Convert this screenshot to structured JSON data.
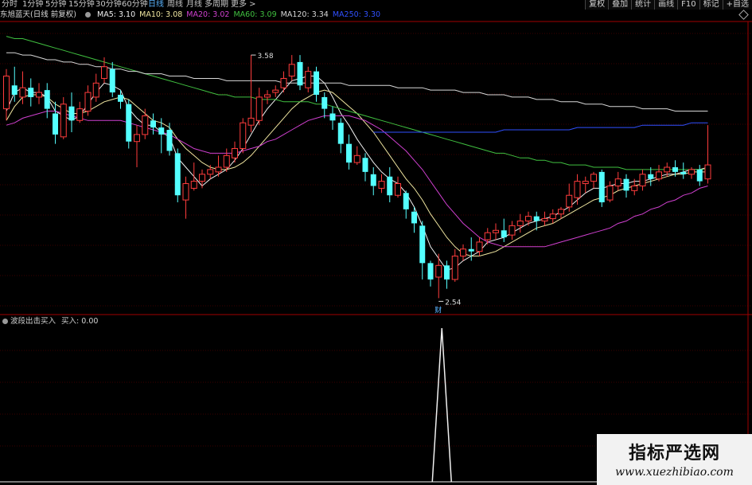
{
  "timeframes": [
    {
      "label": "分时",
      "active": false
    },
    {
      "label": "1分钟",
      "active": false
    },
    {
      "label": "5分钟",
      "active": false
    },
    {
      "label": "15分钟",
      "active": false
    },
    {
      "label": "30分钟",
      "active": false
    },
    {
      "label": "60分钟",
      "active": false
    },
    {
      "label": "日线",
      "active": true
    },
    {
      "label": "周线",
      "active": false
    },
    {
      "label": "月线",
      "active": false
    },
    {
      "label": "多周期",
      "active": false
    },
    {
      "label": "更多 >",
      "active": false
    }
  ],
  "tools": [
    "复权",
    "叠加",
    "统计",
    "画线",
    "F10",
    "标记",
    "+自选"
  ],
  "stock": {
    "name": "东旭蓝天(日线 前复权)"
  },
  "ma_legend": [
    {
      "label": "MA5: 3.10",
      "color": "#f0f0f0"
    },
    {
      "label": "MA10: 3.08",
      "color": "#f0e6a0"
    },
    {
      "label": "MA20: 3.02",
      "color": "#d040d0"
    },
    {
      "label": "MA60: 3.09",
      "color": "#40c040"
    },
    {
      "label": "MA120: 3.34",
      "color": "#d8d8d8"
    },
    {
      "label": "MA250: 3.30",
      "color": "#3050ff"
    }
  ],
  "indicator": {
    "name": "波段出击买入",
    "value_label": "买入: 0.00"
  },
  "annotations": {
    "high": "3.58",
    "low": "2.54",
    "marker": "财"
  },
  "watermark": {
    "title": "指标严选网",
    "url": "www.xuezhibiao.com"
  },
  "chart_data": {
    "type": "candlestick",
    "ylim": [
      2.48,
      3.72
    ],
    "candles": [
      [
        3.35,
        3.49,
        3.52,
        3.3
      ],
      [
        3.45,
        3.41,
        3.53,
        3.38
      ],
      [
        3.4,
        3.44,
        3.51,
        3.37
      ],
      [
        3.44,
        3.4,
        3.48,
        3.36
      ],
      [
        3.4,
        3.42,
        3.46,
        3.37
      ],
      [
        3.43,
        3.35,
        3.46,
        3.31
      ],
      [
        3.33,
        3.24,
        3.38,
        3.2
      ],
      [
        3.23,
        3.37,
        3.4,
        3.22
      ],
      [
        3.36,
        3.3,
        3.42,
        3.25
      ],
      [
        3.3,
        3.35,
        3.38,
        3.29
      ],
      [
        3.34,
        3.42,
        3.45,
        3.32
      ],
      [
        3.4,
        3.46,
        3.5,
        3.38
      ],
      [
        3.48,
        3.53,
        3.57,
        3.46
      ],
      [
        3.52,
        3.42,
        3.55,
        3.4
      ],
      [
        3.41,
        3.38,
        3.43,
        3.35
      ],
      [
        3.37,
        3.21,
        3.39,
        3.18
      ],
      [
        3.21,
        3.24,
        3.28,
        3.1
      ],
      [
        3.24,
        3.32,
        3.35,
        3.22
      ],
      [
        3.3,
        3.27,
        3.33,
        3.24
      ],
      [
        3.27,
        3.24,
        3.31,
        3.16
      ],
      [
        3.26,
        3.17,
        3.29,
        3.15
      ],
      [
        3.16,
        2.98,
        3.18,
        2.95
      ],
      [
        2.96,
        3.03,
        3.06,
        2.88
      ],
      [
        3.01,
        3.04,
        3.12,
        3.0
      ],
      [
        3.04,
        3.07,
        3.09,
        3.01
      ],
      [
        3.07,
        3.09,
        3.11,
        3.05
      ],
      [
        3.08,
        3.1,
        3.15,
        3.06
      ],
      [
        3.1,
        3.15,
        3.18,
        3.08
      ],
      [
        3.14,
        3.18,
        3.21,
        3.12
      ],
      [
        3.18,
        3.29,
        3.31,
        3.16
      ],
      [
        3.28,
        3.31,
        3.58,
        3.25
      ],
      [
        3.3,
        3.4,
        3.44,
        3.28
      ],
      [
        3.4,
        3.41,
        3.43,
        3.37
      ],
      [
        3.42,
        3.43,
        3.45,
        3.4
      ],
      [
        3.44,
        3.48,
        3.51,
        3.42
      ],
      [
        3.49,
        3.54,
        3.58,
        3.47
      ],
      [
        3.55,
        3.45,
        3.58,
        3.43
      ],
      [
        3.44,
        3.51,
        3.53,
        3.42
      ],
      [
        3.51,
        3.41,
        3.53,
        3.38
      ],
      [
        3.4,
        3.35,
        3.42,
        3.31
      ],
      [
        3.33,
        3.3,
        3.36,
        3.26
      ],
      [
        3.29,
        3.2,
        3.31,
        3.16
      ],
      [
        3.2,
        3.12,
        3.24,
        3.09
      ],
      [
        3.12,
        3.15,
        3.19,
        3.11
      ],
      [
        3.14,
        3.08,
        3.16,
        3.04
      ],
      [
        3.07,
        3.02,
        3.1,
        2.98
      ],
      [
        3.01,
        3.04,
        3.07,
        2.99
      ],
      [
        3.06,
        2.98,
        3.1,
        2.95
      ],
      [
        2.98,
        3.03,
        3.06,
        2.97
      ],
      [
        2.99,
        2.92,
        3.0,
        2.88
      ],
      [
        2.91,
        2.86,
        2.93,
        2.82
      ],
      [
        2.85,
        2.69,
        2.87,
        2.62
      ],
      [
        2.69,
        2.62,
        2.7,
        2.59
      ],
      [
        2.63,
        2.68,
        2.73,
        2.54
      ],
      [
        2.68,
        2.62,
        2.7,
        2.58
      ],
      [
        2.62,
        2.72,
        2.75,
        2.61
      ],
      [
        2.72,
        2.75,
        2.77,
        2.7
      ],
      [
        2.75,
        2.74,
        2.8,
        2.7
      ],
      [
        2.74,
        2.78,
        2.8,
        2.72
      ],
      [
        2.79,
        2.82,
        2.84,
        2.77
      ],
      [
        2.82,
        2.83,
        2.86,
        2.79
      ],
      [
        2.83,
        2.8,
        2.88,
        2.78
      ],
      [
        2.81,
        2.85,
        2.87,
        2.79
      ],
      [
        2.85,
        2.87,
        2.9,
        2.82
      ],
      [
        2.87,
        2.89,
        2.91,
        2.85
      ],
      [
        2.89,
        2.87,
        2.91,
        2.83
      ],
      [
        2.87,
        2.88,
        2.91,
        2.85
      ],
      [
        2.88,
        2.9,
        2.92,
        2.86
      ],
      [
        2.9,
        2.92,
        2.93,
        2.88
      ],
      [
        2.93,
        2.98,
        3.03,
        2.91
      ],
      [
        2.97,
        3.04,
        3.07,
        2.94
      ],
      [
        3.03,
        3.04,
        3.06,
        2.99
      ],
      [
        3.04,
        3.07,
        3.08,
        3.01
      ],
      [
        3.08,
        2.95,
        3.09,
        2.93
      ],
      [
        2.96,
        3.02,
        3.04,
        2.95
      ],
      [
        3.02,
        3.05,
        3.08,
        3.0
      ],
      [
        3.05,
        3.0,
        3.07,
        2.97
      ],
      [
        3.0,
        3.02,
        3.05,
        2.98
      ],
      [
        3.02,
        3.07,
        3.09,
        3.0
      ],
      [
        3.07,
        3.05,
        3.1,
        3.02
      ],
      [
        3.05,
        3.08,
        3.11,
        3.04
      ],
      [
        3.08,
        3.1,
        3.12,
        3.06
      ],
      [
        3.1,
        3.08,
        3.13,
        3.06
      ],
      [
        3.08,
        3.07,
        3.12,
        3.05
      ],
      [
        3.07,
        3.09,
        3.1,
        3.05
      ],
      [
        3.09,
        3.04,
        3.11,
        3.02
      ],
      [
        3.05,
        3.11,
        3.28,
        3.03
      ]
    ],
    "ma_lines": [
      {
        "name": "MA5",
        "color": "#f0f0f0",
        "values": [
          3.34,
          3.42,
          3.44,
          3.42,
          3.42,
          3.4,
          3.34,
          3.32,
          3.3,
          3.32,
          3.37,
          3.42,
          3.46,
          3.45,
          3.43,
          3.35,
          3.31,
          3.28,
          3.28,
          3.25,
          3.23,
          3.14,
          3.1,
          3.06,
          3.02,
          3.05,
          3.07,
          3.09,
          3.13,
          3.18,
          3.24,
          3.3,
          3.35,
          3.39,
          3.43,
          3.47,
          3.48,
          3.49,
          3.49,
          3.46,
          3.4,
          3.33,
          3.28,
          3.22,
          3.17,
          3.12,
          3.08,
          3.05,
          3.03,
          2.99,
          2.93,
          2.85,
          2.76,
          2.71,
          2.66,
          2.67,
          2.7,
          2.72,
          2.74,
          2.78,
          2.79,
          2.8,
          2.82,
          2.84,
          2.86,
          2.87,
          2.88,
          2.89,
          2.91,
          2.93,
          2.96,
          2.99,
          3.01,
          3.01,
          3.02,
          3.03,
          3.03,
          3.04,
          3.04,
          3.05,
          3.06,
          3.07,
          3.07,
          3.08,
          3.09,
          3.09,
          3.1
        ]
      },
      {
        "name": "MA10",
        "color": "#f0e6a0",
        "values": [
          3.3,
          3.36,
          3.4,
          3.41,
          3.41,
          3.4,
          3.37,
          3.35,
          3.33,
          3.33,
          3.34,
          3.36,
          3.38,
          3.39,
          3.4,
          3.39,
          3.36,
          3.33,
          3.3,
          3.29,
          3.27,
          3.22,
          3.18,
          3.15,
          3.12,
          3.1,
          3.09,
          3.09,
          3.1,
          3.12,
          3.15,
          3.19,
          3.23,
          3.27,
          3.31,
          3.35,
          3.38,
          3.4,
          3.42,
          3.43,
          3.42,
          3.39,
          3.36,
          3.33,
          3.29,
          3.25,
          3.2,
          3.15,
          3.1,
          3.05,
          3.01,
          2.96,
          2.9,
          2.85,
          2.8,
          2.76,
          2.73,
          2.72,
          2.72,
          2.73,
          2.74,
          2.76,
          2.78,
          2.8,
          2.82,
          2.84,
          2.85,
          2.86,
          2.88,
          2.9,
          2.92,
          2.94,
          2.96,
          2.97,
          2.98,
          3.0,
          3.01,
          3.02,
          3.03,
          3.04,
          3.05,
          3.06,
          3.07,
          3.07,
          3.08,
          3.08,
          3.08
        ]
      },
      {
        "name": "MA20",
        "color": "#d040d0",
        "values": [
          3.28,
          3.29,
          3.31,
          3.32,
          3.33,
          3.34,
          3.34,
          3.33,
          3.32,
          3.31,
          3.3,
          3.3,
          3.3,
          3.3,
          3.3,
          3.29,
          3.28,
          3.27,
          3.26,
          3.25,
          3.24,
          3.22,
          3.2,
          3.18,
          3.17,
          3.16,
          3.16,
          3.16,
          3.16,
          3.17,
          3.18,
          3.19,
          3.21,
          3.22,
          3.24,
          3.26,
          3.28,
          3.3,
          3.31,
          3.32,
          3.32,
          3.32,
          3.32,
          3.31,
          3.3,
          3.28,
          3.26,
          3.23,
          3.2,
          3.17,
          3.13,
          3.09,
          3.04,
          2.99,
          2.94,
          2.9,
          2.86,
          2.83,
          2.8,
          2.78,
          2.77,
          2.76,
          2.76,
          2.76,
          2.76,
          2.76,
          2.76,
          2.77,
          2.78,
          2.79,
          2.8,
          2.81,
          2.82,
          2.83,
          2.84,
          2.86,
          2.87,
          2.89,
          2.9,
          2.92,
          2.93,
          2.95,
          2.96,
          2.98,
          2.99,
          3.01,
          3.02
        ]
      },
      {
        "name": "MA60",
        "color": "#40c040",
        "values": [
          3.66,
          3.65,
          3.65,
          3.64,
          3.63,
          3.62,
          3.61,
          3.6,
          3.59,
          3.58,
          3.57,
          3.56,
          3.55,
          3.54,
          3.53,
          3.52,
          3.51,
          3.5,
          3.49,
          3.48,
          3.47,
          3.46,
          3.45,
          3.44,
          3.43,
          3.42,
          3.41,
          3.41,
          3.4,
          3.4,
          3.4,
          3.39,
          3.39,
          3.39,
          3.38,
          3.38,
          3.38,
          3.38,
          3.37,
          3.37,
          3.36,
          3.35,
          3.34,
          3.33,
          3.32,
          3.31,
          3.3,
          3.29,
          3.28,
          3.27,
          3.26,
          3.25,
          3.24,
          3.23,
          3.22,
          3.21,
          3.2,
          3.19,
          3.18,
          3.17,
          3.16,
          3.16,
          3.15,
          3.14,
          3.14,
          3.13,
          3.13,
          3.12,
          3.12,
          3.11,
          3.11,
          3.11,
          3.1,
          3.1,
          3.1,
          3.1,
          3.09,
          3.09,
          3.09,
          3.09,
          3.09,
          3.09,
          3.09,
          3.09,
          3.09,
          3.09,
          3.09
        ]
      },
      {
        "name": "MA120",
        "color": "#d8d8d8",
        "values": [
          3.59,
          3.59,
          3.58,
          3.58,
          3.57,
          3.56,
          3.56,
          3.55,
          3.55,
          3.54,
          3.54,
          3.53,
          3.53,
          3.52,
          3.52,
          3.51,
          3.51,
          3.5,
          3.5,
          3.5,
          3.49,
          3.49,
          3.49,
          3.48,
          3.48,
          3.48,
          3.48,
          3.47,
          3.47,
          3.47,
          3.47,
          3.47,
          3.47,
          3.47,
          3.46,
          3.46,
          3.46,
          3.46,
          3.46,
          3.46,
          3.46,
          3.46,
          3.45,
          3.45,
          3.45,
          3.45,
          3.45,
          3.45,
          3.44,
          3.44,
          3.44,
          3.44,
          3.43,
          3.43,
          3.43,
          3.43,
          3.42,
          3.42,
          3.42,
          3.41,
          3.41,
          3.41,
          3.4,
          3.4,
          3.4,
          3.39,
          3.39,
          3.39,
          3.38,
          3.38,
          3.38,
          3.37,
          3.37,
          3.37,
          3.36,
          3.36,
          3.36,
          3.36,
          3.35,
          3.35,
          3.35,
          3.35,
          3.34,
          3.34,
          3.34,
          3.34,
          3.34
        ]
      },
      {
        "name": "MA250",
        "color": "#3050ff",
        "start": 45,
        "values": [
          3.25,
          3.25,
          3.25,
          3.25,
          3.25,
          3.25,
          3.25,
          3.25,
          3.25,
          3.25,
          3.25,
          3.25,
          3.25,
          3.25,
          3.25,
          3.25,
          3.26,
          3.26,
          3.26,
          3.26,
          3.26,
          3.26,
          3.26,
          3.26,
          3.26,
          3.27,
          3.27,
          3.27,
          3.27,
          3.27,
          3.27,
          3.27,
          3.27,
          3.28,
          3.28,
          3.28,
          3.28,
          3.28,
          3.28,
          3.29,
          3.29,
          3.29
        ]
      }
    ],
    "signal": {
      "name": "波段出击买入",
      "peak_index": 53,
      "values_max": 1
    },
    "high_index": 30,
    "low_index": 53
  }
}
